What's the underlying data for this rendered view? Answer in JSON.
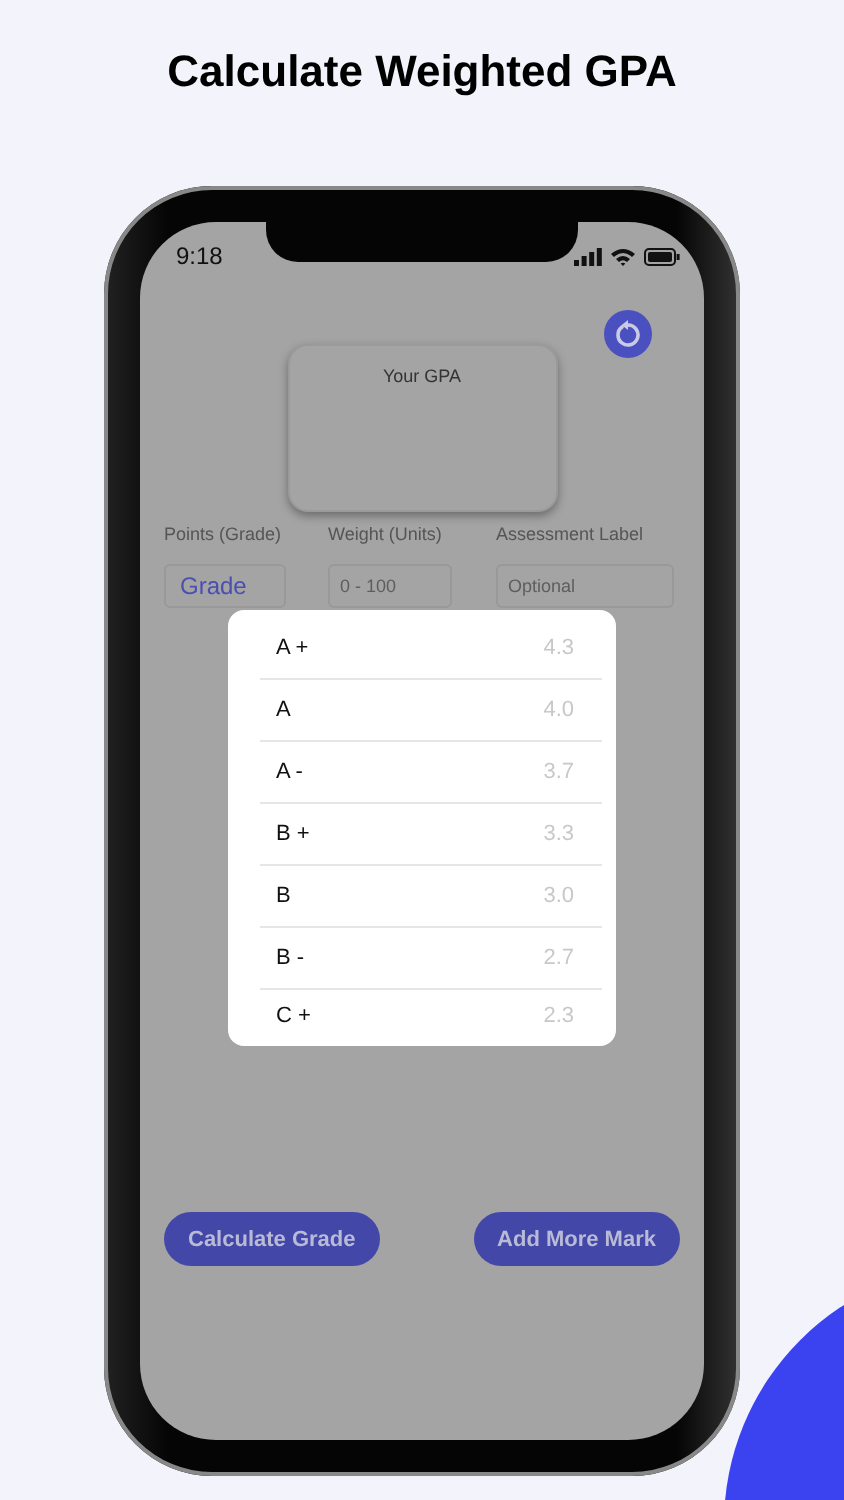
{
  "headline": "Calculate Weighted GPA",
  "status_bar": {
    "time": "9:18"
  },
  "gpa_card": {
    "title": "Your GPA"
  },
  "columns": [
    {
      "label": "Points (Grade)",
      "field": {
        "value": "Grade"
      }
    },
    {
      "label": "Weight (Units)",
      "field": {
        "placeholder": "0 - 100"
      }
    },
    {
      "label": "Assessment Label",
      "field": {
        "placeholder": "Optional"
      }
    }
  ],
  "grade_picker": {
    "options": [
      {
        "grade": "A +",
        "points": "4.3"
      },
      {
        "grade": "A",
        "points": "4.0"
      },
      {
        "grade": "A -",
        "points": "3.7"
      },
      {
        "grade": "B +",
        "points": "3.3"
      },
      {
        "grade": "B",
        "points": "3.0"
      },
      {
        "grade": "B -",
        "points": "2.7"
      },
      {
        "grade": "C +",
        "points": "2.3"
      }
    ]
  },
  "buttons": [
    "Calculate Grade",
    "Add More Mark"
  ]
}
